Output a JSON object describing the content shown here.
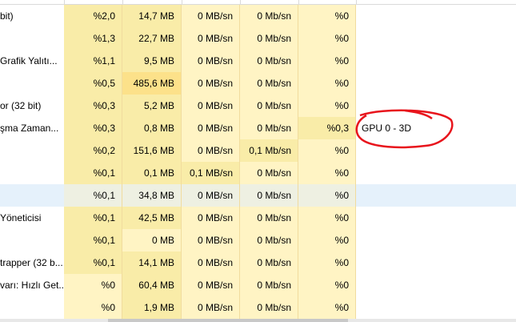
{
  "rows": [
    {
      "name": "bit)",
      "cpu": "%2,0",
      "mem": "14,7 MB",
      "disk": "0 MB/sn",
      "net": "0 Mb/sn",
      "gpu": "%0",
      "engine": ""
    },
    {
      "name": "",
      "cpu": "%1,3",
      "mem": "22,7 MB",
      "disk": "0 MB/sn",
      "net": "0 Mb/sn",
      "gpu": "%0",
      "engine": ""
    },
    {
      "name": "Grafik Yalıtı...",
      "cpu": "%1,1",
      "mem": "9,5 MB",
      "disk": "0 MB/sn",
      "net": "0 Mb/sn",
      "gpu": "%0",
      "engine": ""
    },
    {
      "name": "",
      "cpu": "%0,5",
      "mem": "485,6 MB",
      "disk": "0 MB/sn",
      "net": "0 Mb/sn",
      "gpu": "%0",
      "engine": ""
    },
    {
      "name": "or (32 bit)",
      "cpu": "%0,3",
      "mem": "5,2 MB",
      "disk": "0 MB/sn",
      "net": "0 Mb/sn",
      "gpu": "%0",
      "engine": ""
    },
    {
      "name": "şma Zaman...",
      "cpu": "%0,3",
      "mem": "0,8 MB",
      "disk": "0 MB/sn",
      "net": "0 Mb/sn",
      "gpu": "%0,3",
      "engine": "GPU 0 - 3D"
    },
    {
      "name": "",
      "cpu": "%0,2",
      "mem": "151,6 MB",
      "disk": "0 MB/sn",
      "net": "0,1 Mb/sn",
      "gpu": "%0",
      "engine": ""
    },
    {
      "name": "",
      "cpu": "%0,1",
      "mem": "0,1 MB",
      "disk": "0,1 MB/sn",
      "net": "0 Mb/sn",
      "gpu": "%0",
      "engine": ""
    },
    {
      "name": "",
      "cpu": "%0,1",
      "mem": "34,8 MB",
      "disk": "0 MB/sn",
      "net": "0 Mb/sn",
      "gpu": "%0",
      "engine": "",
      "selected": true
    },
    {
      "name": "Yöneticisi",
      "cpu": "%0,1",
      "mem": "42,5 MB",
      "disk": "0 MB/sn",
      "net": "0 Mb/sn",
      "gpu": "%0",
      "engine": ""
    },
    {
      "name": "",
      "cpu": "%0,1",
      "mem": "0 MB",
      "disk": "0 MB/sn",
      "net": "0 Mb/sn",
      "gpu": "%0",
      "engine": ""
    },
    {
      "name": "trapper (32 b...",
      "cpu": "%0,1",
      "mem": "14,1 MB",
      "disk": "0 MB/sn",
      "net": "0 Mb/sn",
      "gpu": "%0",
      "engine": ""
    },
    {
      "name": "varı: Hızlı Get...",
      "cpu": "%0",
      "mem": "60,4 MB",
      "disk": "0 MB/sn",
      "net": "0 Mb/sn",
      "gpu": "%0",
      "engine": ""
    },
    {
      "name": "",
      "cpu": "%0",
      "mem": "1,9 MB",
      "disk": "0 MB/sn",
      "net": "0 Mb/sn",
      "gpu": "%0",
      "engine": ""
    }
  ],
  "colors": {
    "light": "#fff4c4",
    "mid": "#f9eca8",
    "dark": "#fce18a",
    "annotation": "#e8141c"
  }
}
